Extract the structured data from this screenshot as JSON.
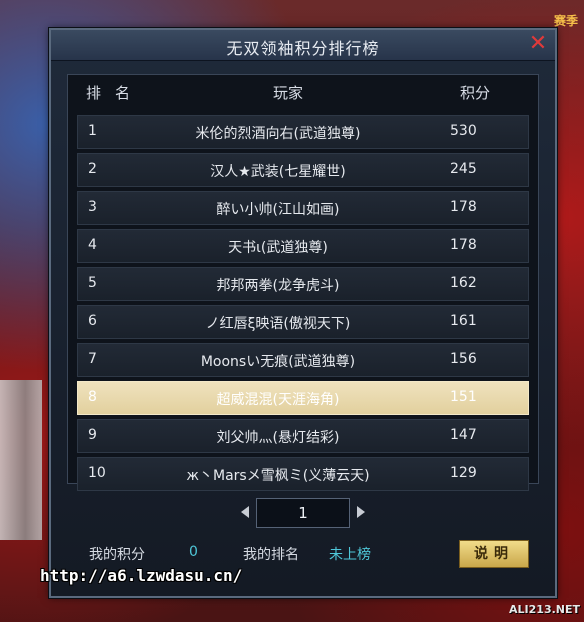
{
  "background": {
    "corner_text": "赛季"
  },
  "panel": {
    "title": "无双领袖积分排行榜",
    "close_glyph": "✕"
  },
  "table": {
    "headers": {
      "rank": "排名",
      "player": "玩家",
      "score": "积分"
    },
    "rows": [
      {
        "rank": "1",
        "name": "米伦的烈酒向右(武道独尊)",
        "score": "530"
      },
      {
        "rank": "2",
        "name": "汉人★武装(七星耀世)",
        "score": "245"
      },
      {
        "rank": "3",
        "name": "醉い小帅(江山如画)",
        "score": "178"
      },
      {
        "rank": "4",
        "name": "天书ι(武道独尊)",
        "score": "178"
      },
      {
        "rank": "5",
        "name": "邦邦两拳(龙争虎斗)",
        "score": "162"
      },
      {
        "rank": "6",
        "name": "ノ红唇ξ映语(傲视天下)",
        "score": "161"
      },
      {
        "rank": "7",
        "name": "Moonsい无痕(武道独尊)",
        "score": "156"
      },
      {
        "rank": "8",
        "name": "超威混混(天涯海角)",
        "score": "151"
      },
      {
        "rank": "9",
        "name": "刘父帅灬(悬灯结彩)",
        "score": "147"
      },
      {
        "rank": "10",
        "name": "ж丶Marsメ雪枫ミ(义薄云天)",
        "score": "129"
      }
    ],
    "selected_rank": "8"
  },
  "pager": {
    "page": "1"
  },
  "footer": {
    "my_score_label": "我的积分",
    "my_score": "0",
    "my_rank_label": "我的排名",
    "my_rank": "未上榜",
    "help_button": "说明"
  },
  "watermarks": {
    "url": "http://a6.lzwdasu.cn/",
    "brand": "ALI213.NET"
  },
  "colors": {
    "accent_cyan": "#4fc7d9",
    "close_red": "#e03a3a",
    "selected_row": "#e2d09e"
  }
}
